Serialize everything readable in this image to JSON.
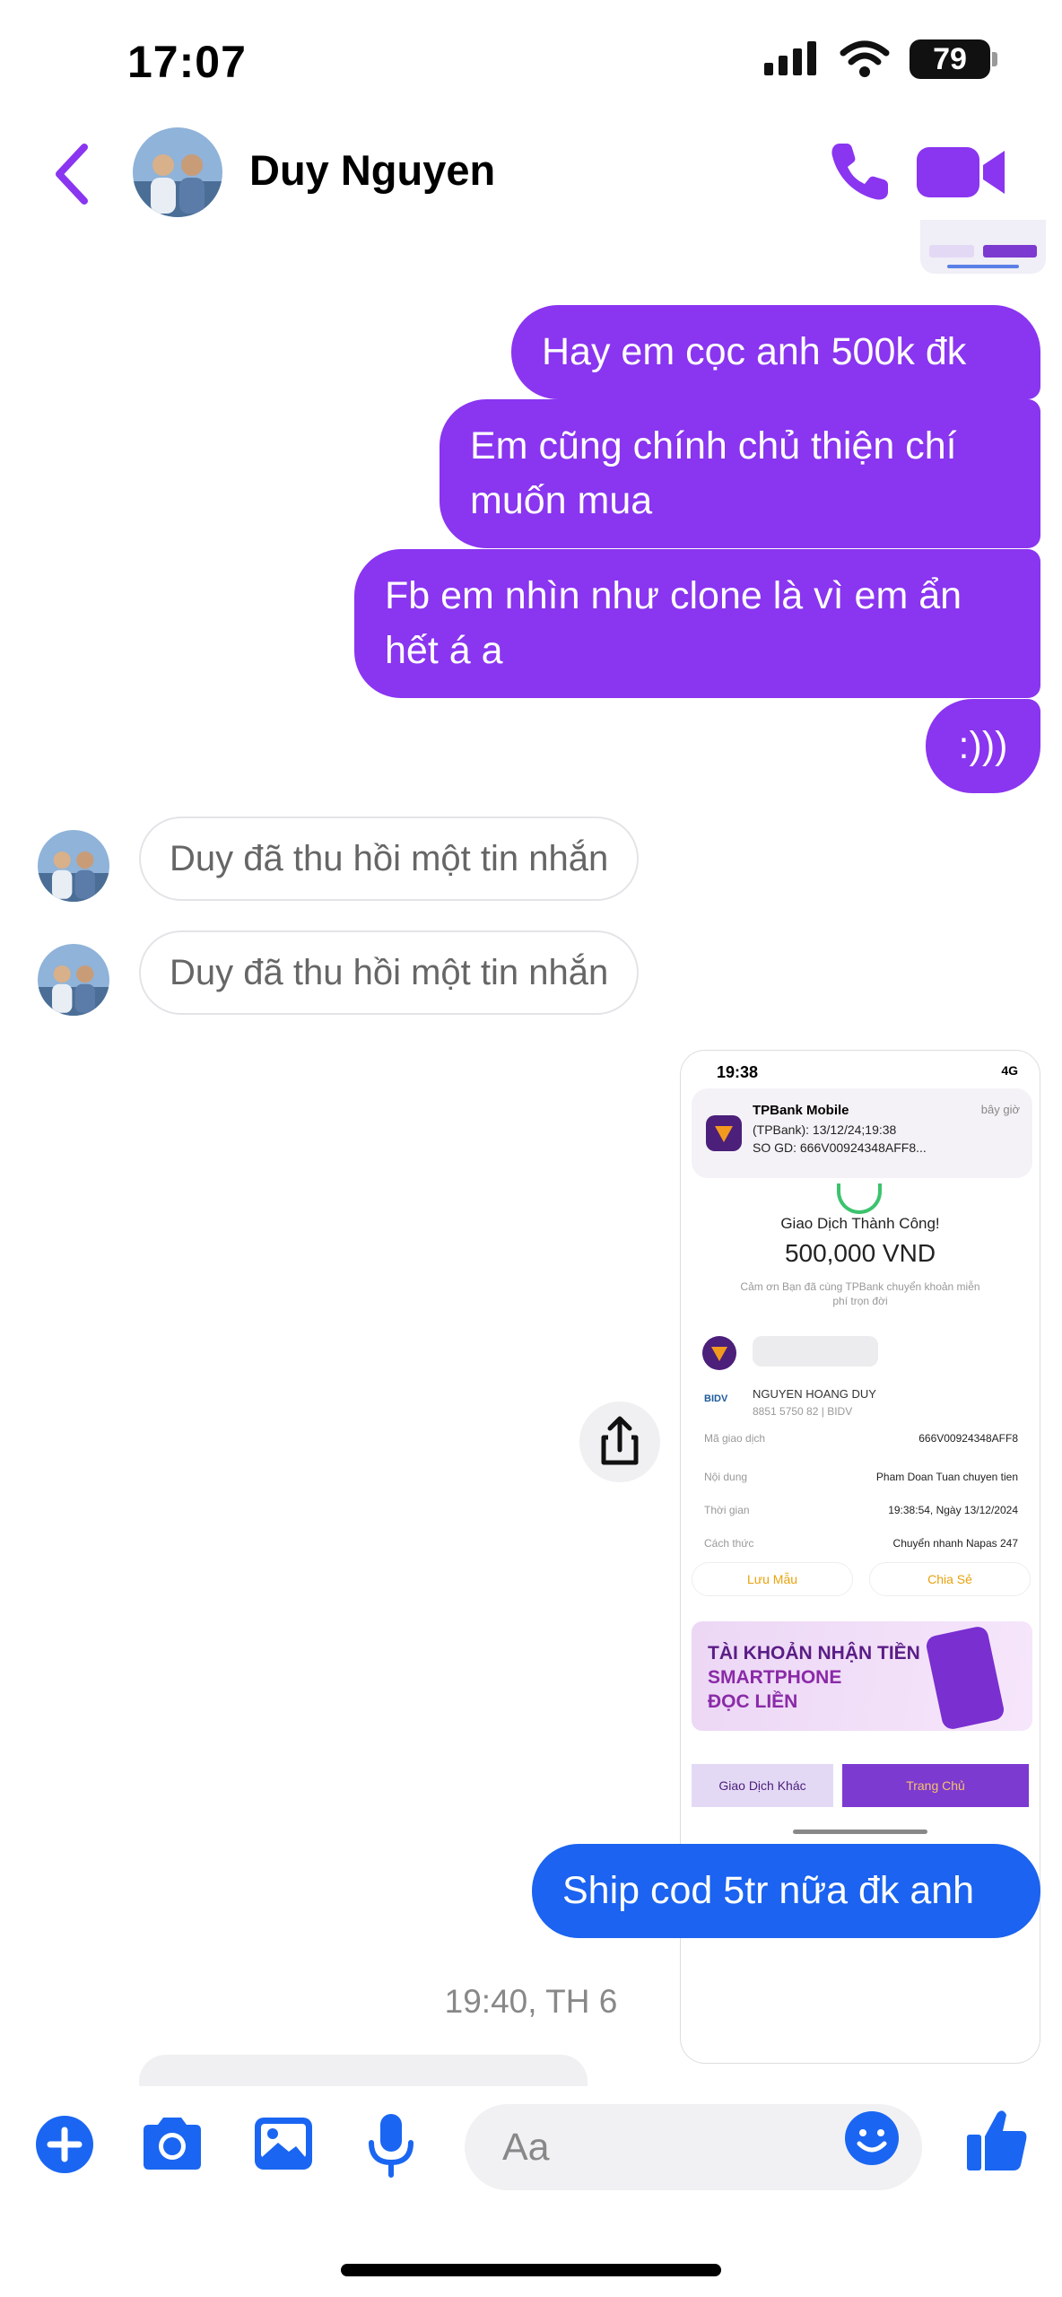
{
  "status": {
    "time": "17:07",
    "battery": "79"
  },
  "header": {
    "contact_name": "Duy Nguyen"
  },
  "messages": {
    "sent": [
      {
        "line1": "Hay em cọc anh 500k đk"
      },
      {
        "line1": "Em cũng chính chủ thiện chí",
        "line2": "muốn mua"
      },
      {
        "line1": "Fb em nhìn như clone là vì em ẩn",
        "line2": "hết á a"
      },
      {
        "line1": ":)))"
      }
    ],
    "recalled": [
      {
        "text": "Duy đã thu hồi một tin nhắn"
      },
      {
        "text": "Duy đã thu hồi một tin nhắn"
      }
    ],
    "last_sent": "Ship cod 5tr nữa đk anh",
    "timestamp": "19:40, TH 6"
  },
  "receipt": {
    "time": "19:38",
    "net": "4G",
    "notif_title": "TPBank Mobile",
    "notif_time": "bây giờ",
    "notif_line1": "(TPBank): 13/12/24;19:38",
    "notif_line2": "SO GD: 666V00924348AFF8...",
    "success": "Giao Dịch Thành Công!",
    "amount": "500,000 VND",
    "thanks": "Cảm ơn Bạn đã cùng TPBank chuyển khoản miễn phí trọn đời",
    "bidv": "BIDV",
    "recipient_name": "NGUYEN HOANG DUY",
    "recipient_acc": "8851 5750 82 | BIDV",
    "rows": [
      {
        "k": "Mã giao dịch",
        "v": "666V00924348AFF8"
      },
      {
        "k": "Nội dung",
        "v": "Pham Doan Tuan chuyen tien"
      },
      {
        "k": "Thời gian",
        "v": "19:38:54, Ngày 13/12/2024"
      },
      {
        "k": "Cách thức",
        "v": "Chuyển nhanh Napas 247"
      }
    ],
    "save_label": "Lưu Mẫu",
    "share_label": "Chia Sẻ",
    "banner_line1": "TÀI KHOẢN NHẬN TIỀN",
    "banner_line2": "SMARTPHONE",
    "banner_line3": "ĐỌC LIỀN",
    "btn_other": "Giao Dịch Khác",
    "btn_home": "Trang Chủ"
  },
  "composer": {
    "placeholder": "Aa"
  },
  "colors": {
    "accent": "#8a35f0",
    "blue_bubble": "#1b63f0",
    "icon_blue": "#1a66f2"
  }
}
